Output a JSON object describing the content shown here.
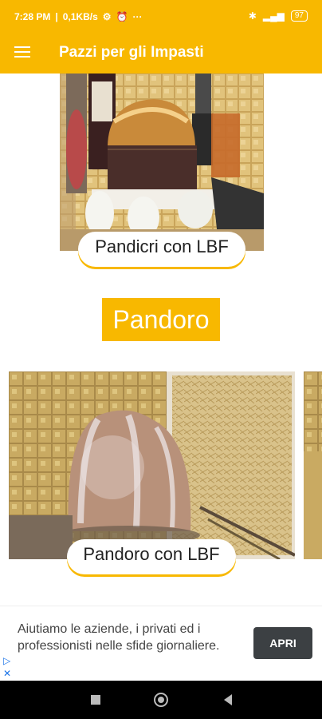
{
  "status_bar": {
    "time": "7:28 PM",
    "speed": "0,1KB/s",
    "battery": "97"
  },
  "app_bar": {
    "title": "Pazzi per gli Impasti"
  },
  "items": [
    {
      "caption": "Pandicri con LBF"
    },
    {
      "caption": "Pandoro con LBF"
    }
  ],
  "section": {
    "title": "Pandoro"
  },
  "ad": {
    "text": "Aiutiamo le aziende, i privati ed i professionisti nelle sfide giornaliere.",
    "button": "APRI"
  },
  "colors": {
    "accent": "#f8b800"
  }
}
